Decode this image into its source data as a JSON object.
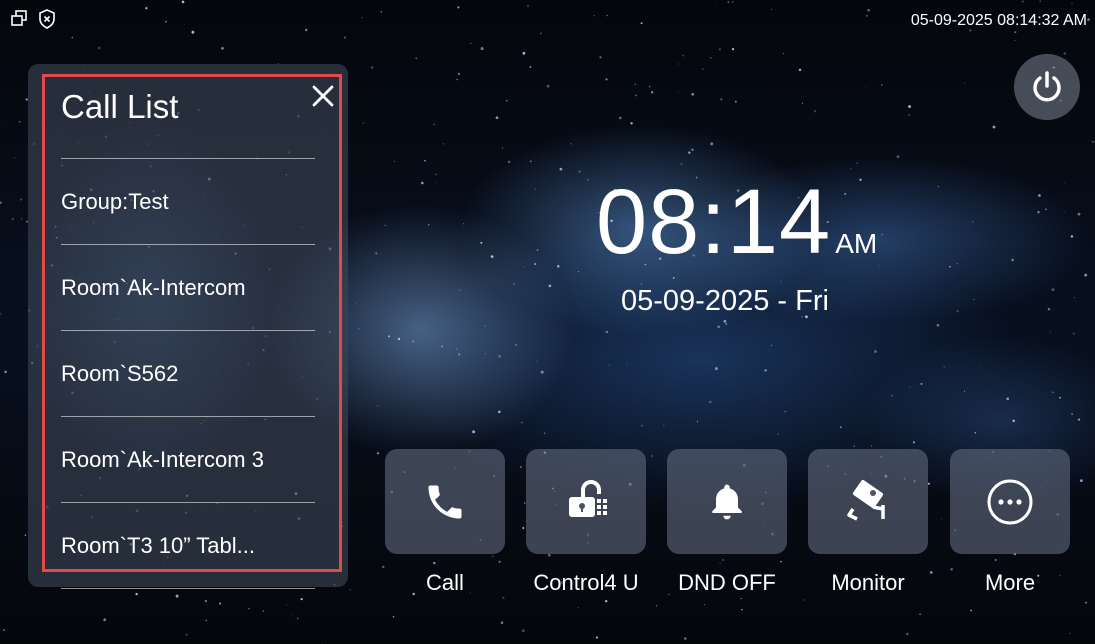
{
  "status_bar": {
    "datetime": "05-09-2025 08:14:32 AM"
  },
  "clock": {
    "time": "08:14",
    "ampm": "AM",
    "date": "05-09-2025 - Fri"
  },
  "call_list": {
    "title": "Call List",
    "items": [
      {
        "label": "Group:Test"
      },
      {
        "label": "Room`Ak-Intercom"
      },
      {
        "label": "Room`S562"
      },
      {
        "label": "Room`Ak-Intercom 3"
      },
      {
        "label": "Room`T3 10”   Tabl..."
      }
    ]
  },
  "actions": [
    {
      "label": "Call",
      "icon": "phone-icon"
    },
    {
      "label": "Control4 U",
      "icon": "unlock-icon"
    },
    {
      "label": "DND OFF",
      "icon": "bell-icon"
    },
    {
      "label": "Monitor",
      "icon": "camera-icon"
    },
    {
      "label": "More",
      "icon": "more-icon"
    }
  ],
  "colors": {
    "highlight": "#e24a4a",
    "panel": "#3c4656",
    "button": "#5f697d"
  }
}
